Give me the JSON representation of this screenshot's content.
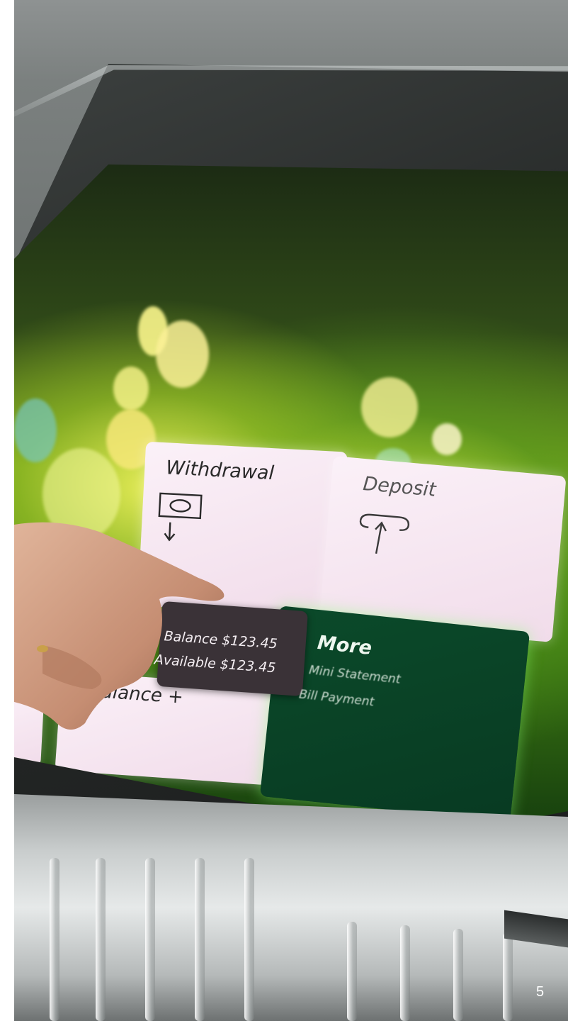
{
  "screen": {
    "tiles": {
      "withdrawal": {
        "title": "Withdrawal"
      },
      "deposit": {
        "title": "Deposit"
      },
      "balance_info": {
        "balance": "Balance $123.45",
        "available": "Available $123.45"
      },
      "balance": {
        "title": "Balance +"
      },
      "more": {
        "title": "More",
        "items": [
          "Mini Statement",
          "Bill Payment"
        ]
      }
    }
  },
  "page_number": "5",
  "colors": {
    "screen_green": "#6d9a1c",
    "tile_light": "#fbf1f8",
    "tile_dark": "#0b4a2a",
    "info_pill": "#3a3237"
  },
  "icons": {
    "withdrawal": "cash-out-icon",
    "deposit": "cash-in-icon"
  }
}
